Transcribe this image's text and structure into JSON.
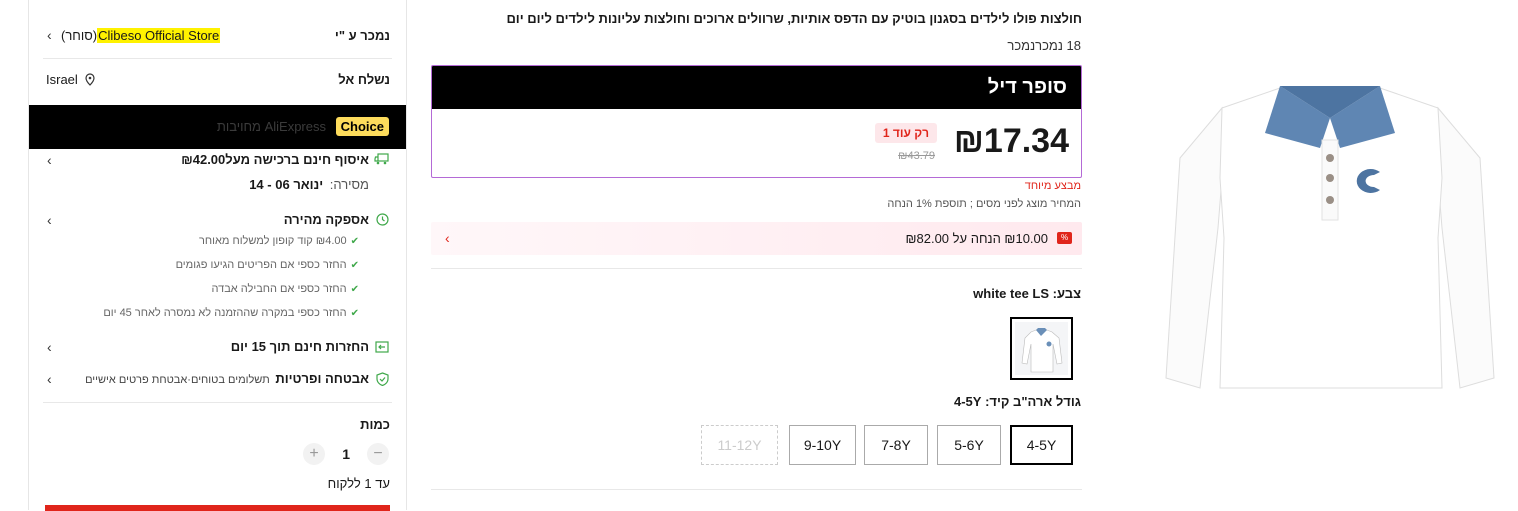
{
  "seller": {
    "label": "נמכר ע \"י",
    "store_name": "Clibeso Official Store",
    "seller_tag": "(סוחר)"
  },
  "ship_to": {
    "label": "נשלח אל",
    "country": "Israel"
  },
  "choice": {
    "badge": "Choice",
    "text": "AliExpress מחויבות"
  },
  "delivery": {
    "title": "איסוף חינם ברכישה מעל₪42.00",
    "date_label": "מסירה:",
    "date_value": "ינואר 06 - 14"
  },
  "fast_delivery": {
    "title": "אספקה מהירה",
    "items": [
      "₪4.00 קוד קופון למשלוח מאוחר",
      "החזר כספי אם הפריטים הגיעו פגומים",
      "החזר כספי אם החבילה אבדה",
      "החזר כספי במקרה שההזמנה לא נמסרה לאחר 45 יום"
    ]
  },
  "returns": {
    "title": "החזרות חינם תוך 15 יום"
  },
  "security": {
    "title": "אבטחה ופרטיות",
    "subtitle": "תשלומים בטוחים·אבטחת פרטים אישיים"
  },
  "quantity": {
    "label": "כמות",
    "value": "1",
    "limit": "עד 1 ללקוח",
    "minus": "−",
    "plus": "+"
  },
  "product": {
    "title": "חולצות פולו לילדים בסגנון בוטיק עם הדפס אותיות, שרוולים ארוכים וחולצות עליונות לילדים ליום יום",
    "sold": "18 נמכרנמכר"
  },
  "deal": {
    "title": "סופר דיל",
    "price": "₪17.34",
    "old_price": "₪43.79",
    "only_left": "רק עוד 1",
    "special": "מבצע מיוחד",
    "tax_note": "המחיר מוצג לפני מסים ; תוספת 1% הנחה"
  },
  "coupon": {
    "icon": "%",
    "text": "₪10.00 הנחה על ₪82.00"
  },
  "color": {
    "label": "צבע:",
    "value": "white tee LS"
  },
  "size": {
    "label": "גודל ארה\"ב קיד:",
    "value": "4-5Y",
    "options": [
      "4-5Y",
      "5-6Y",
      "7-8Y",
      "9-10Y",
      "11-12Y"
    ]
  },
  "icons": {
    "chevron": "chevron-left-icon",
    "location": "location-pin-icon",
    "truck": "truck-icon",
    "fast": "fast-delivery-icon",
    "check": "check-icon",
    "returns": "return-box-icon",
    "shield": "shield-check-icon"
  },
  "colors": {
    "accent_red": "#e0251b",
    "choice_yellow": "#fddc5c",
    "green": "#3fa84a",
    "deal_border": "#b46ad6"
  }
}
